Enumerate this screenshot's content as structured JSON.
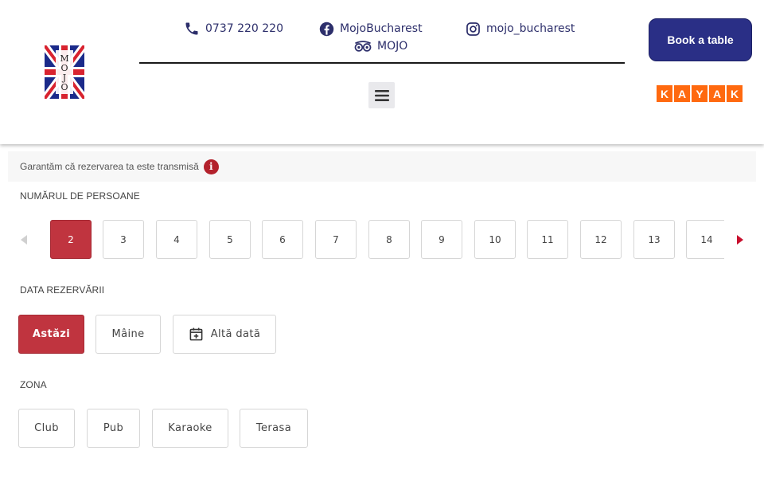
{
  "header": {
    "logo_text": "MOJO",
    "phone": "0737 220 220",
    "facebook": "MojoBucharest",
    "instagram": "mojo_bucharest",
    "tripadvisor": "MOJO",
    "book_label": "Book a table",
    "kayak_letters": [
      "K",
      "A",
      "Y",
      "A",
      "K"
    ],
    "colors": {
      "navy": "#2a2f86",
      "kayak": "#ff690f"
    }
  },
  "notice": {
    "text": "Garantăm că rezervarea ta este transmisă",
    "icon": "i"
  },
  "persons": {
    "label": "NUMĂRUL DE PERSOANE",
    "options": [
      "2",
      "3",
      "4",
      "5",
      "6",
      "7",
      "8",
      "9",
      "10",
      "11",
      "12",
      "13",
      "14"
    ],
    "selected": "2"
  },
  "date": {
    "label": "DATA REZERVĂRII",
    "options": [
      "Astăzi",
      "Mâine",
      "Altă dată"
    ],
    "selected": "Astăzi"
  },
  "zone": {
    "label": "ZONA",
    "options": [
      "Club",
      "Pub",
      "Karaoke",
      "Terasa"
    ]
  },
  "accent_color": "#c0343f"
}
